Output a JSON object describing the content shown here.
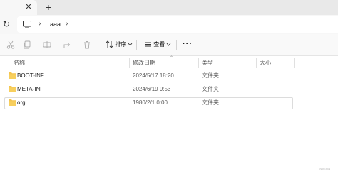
{
  "tabbar": {
    "close_glyph": "✕",
    "new_tab_glyph": "+"
  },
  "addressbar": {
    "refresh_glyph": "↻",
    "breadcrumb": [
      "aaa"
    ],
    "chevron": "›"
  },
  "toolbar": {
    "sort_label": "排序",
    "view_label": "查看",
    "more_label": "···"
  },
  "columns": {
    "name": "名称",
    "modified": "修改日期",
    "type": "类型",
    "size": "大小"
  },
  "files": [
    {
      "name": "BOOT-INF",
      "modified": "2024/5/17 18:20",
      "type": "文件夹",
      "size": "",
      "icon": "folder-icon"
    },
    {
      "name": "META-INF",
      "modified": "2024/6/19 9:53",
      "type": "文件夹",
      "size": "",
      "icon": "folder-icon"
    },
    {
      "name": "org",
      "modified": "1980/2/1 0:00",
      "type": "文件夹",
      "size": "",
      "icon": "folder-icon",
      "selected": true
    }
  ],
  "colors": {
    "folder": "#f4c44e",
    "titlebar": "#e9e9e9",
    "selection_border": "#dcdcdc"
  },
  "watermark": "CSDN @ltl9"
}
